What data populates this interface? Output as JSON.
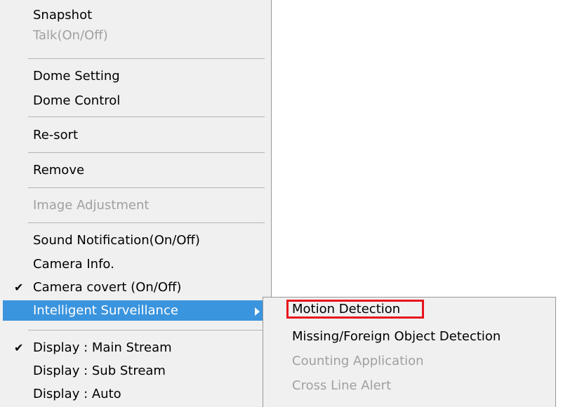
{
  "main_menu": {
    "items": [
      {
        "label": "Snapshot",
        "enabled": true,
        "checked": false
      },
      {
        "label": "Talk(On/Off)",
        "enabled": false,
        "checked": false
      },
      {
        "label": "Dome Setting",
        "enabled": true,
        "checked": false
      },
      {
        "label": "Dome Control",
        "enabled": true,
        "checked": false
      },
      {
        "label": "Re-sort",
        "enabled": true,
        "checked": false
      },
      {
        "label": "Remove",
        "enabled": true,
        "checked": false
      },
      {
        "label": "Image Adjustment",
        "enabled": false,
        "checked": false
      },
      {
        "label": "Sound Notification(On/Off)",
        "enabled": true,
        "checked": false
      },
      {
        "label": "Camera Info.",
        "enabled": true,
        "checked": false
      },
      {
        "label": "Camera covert (On/Off)",
        "enabled": true,
        "checked": true
      },
      {
        "label": "Intelligent Surveillance",
        "enabled": true,
        "checked": false,
        "highlighted": true,
        "has_submenu": true
      },
      {
        "label": "Display : Main Stream",
        "enabled": true,
        "checked": true
      },
      {
        "label": "Display : Sub Stream",
        "enabled": true,
        "checked": false
      },
      {
        "label": "Display : Auto",
        "enabled": true,
        "checked": false
      }
    ]
  },
  "submenu": {
    "items": [
      {
        "label": "Motion Detection",
        "enabled": true,
        "outlined": true
      },
      {
        "label": "Missing/Foreign Object Detection",
        "enabled": true
      },
      {
        "label": "Counting Application",
        "enabled": false
      },
      {
        "label": "Cross Line Alert",
        "enabled": false
      }
    ]
  },
  "glyphs": {
    "check": "✔"
  },
  "colors": {
    "menu_background": "#f0f0f0",
    "highlight": "#3a94de",
    "disabled_text": "#a0a0a0",
    "focus_outline": "#e8141c"
  }
}
